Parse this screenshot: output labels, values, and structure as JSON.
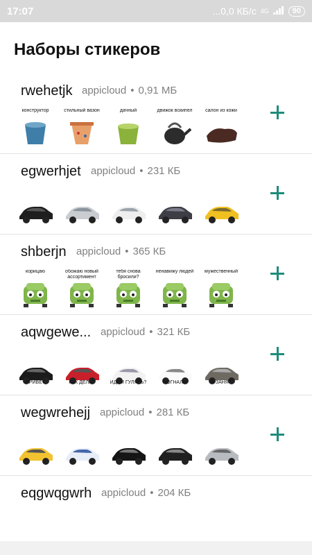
{
  "status": {
    "time": "17:07",
    "speed": "...0,0 КБ/с",
    "network": "4G",
    "battery": "90"
  },
  "title": "Наборы стикеров",
  "packs": [
    {
      "name": "rwehetjk",
      "author": "appicloud",
      "size": "0,91 МБ",
      "stickers": [
        {
          "caption": "конструктор",
          "icon": "bucket-icon"
        },
        {
          "caption": "стильный вазон",
          "icon": "flowerpot-icon"
        },
        {
          "caption": "дачный",
          "icon": "green-bucket-icon"
        },
        {
          "caption": "движок вскипел",
          "icon": "kettle-icon"
        },
        {
          "caption": "салон из кожи",
          "icon": "saddle-icon"
        }
      ]
    },
    {
      "name": "egwerhjet",
      "author": "appicloud",
      "size": "231 КБ",
      "stickers": [
        {
          "caption": "",
          "icon": "black-suv-icon"
        },
        {
          "caption": "",
          "icon": "silver-sedan-icon"
        },
        {
          "caption": "",
          "icon": "white-car-icon"
        },
        {
          "caption": "",
          "icon": "car-trailer-icon"
        },
        {
          "caption": "",
          "icon": "yellow-truck-icon"
        }
      ]
    },
    {
      "name": "shberjn",
      "author": "appicloud",
      "size": "365 КБ",
      "stickers": [
        {
          "caption": "корицаю",
          "icon": "green-car-face-icon"
        },
        {
          "caption": "обожаю новый ассортимент",
          "icon": "green-car-face-icon"
        },
        {
          "caption": "тебя снова бросили?",
          "icon": "green-car-face-icon"
        },
        {
          "caption": "ненавижу людей",
          "icon": "green-car-face-icon"
        },
        {
          "caption": "мужественный",
          "icon": "green-car-face-icon"
        }
      ]
    },
    {
      "name": "aqwgewe...",
      "author": "appicloud",
      "size": "321 КБ",
      "stickers": [
        {
          "caption": "ПРИВЕТ",
          "icon": "black-car-icon"
        },
        {
          "caption": "КАК ДЕЛА?",
          "icon": "red-car-icon"
        },
        {
          "caption": "ИДЕМ ГУЛЯТЬ?",
          "icon": "white-sedan-icon"
        },
        {
          "caption": "ПОГНАЛИ",
          "icon": "white-suv-icon"
        },
        {
          "caption": "Я ЗАНЯТ",
          "icon": "grey-suv-icon"
        }
      ]
    },
    {
      "name": "wegwrehejj",
      "author": "appicloud",
      "size": "281 КБ",
      "stickers": [
        {
          "caption": "",
          "icon": "yellow-mustang-icon"
        },
        {
          "caption": "",
          "icon": "police-car-icon"
        },
        {
          "caption": "",
          "icon": "black-coupe-icon"
        },
        {
          "caption": "",
          "icon": "black-crossover-icon"
        },
        {
          "caption": "",
          "icon": "silver-suv-icon"
        }
      ]
    },
    {
      "name": "eqgwqgwrh",
      "author": "appicloud",
      "size": "204 КБ",
      "stickers": []
    }
  ],
  "separator": "•",
  "colors": {
    "accent": "#1c8c7a",
    "meta": "#808080",
    "statusbar": "#d9d9d9"
  }
}
